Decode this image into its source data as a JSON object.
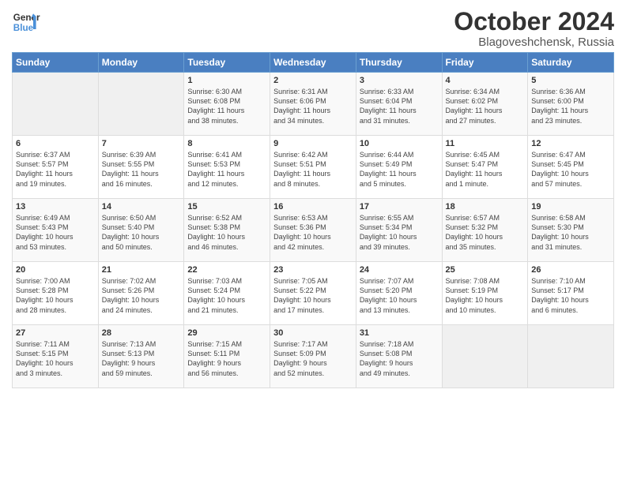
{
  "logo": {
    "line1": "General",
    "line2": "Blue"
  },
  "title": "October 2024",
  "location": "Blagoveshchensk, Russia",
  "days_of_week": [
    "Sunday",
    "Monday",
    "Tuesday",
    "Wednesday",
    "Thursday",
    "Friday",
    "Saturday"
  ],
  "weeks": [
    [
      {
        "day": "",
        "info": ""
      },
      {
        "day": "",
        "info": ""
      },
      {
        "day": "1",
        "info": "Sunrise: 6:30 AM\nSunset: 6:08 PM\nDaylight: 11 hours\nand 38 minutes."
      },
      {
        "day": "2",
        "info": "Sunrise: 6:31 AM\nSunset: 6:06 PM\nDaylight: 11 hours\nand 34 minutes."
      },
      {
        "day": "3",
        "info": "Sunrise: 6:33 AM\nSunset: 6:04 PM\nDaylight: 11 hours\nand 31 minutes."
      },
      {
        "day": "4",
        "info": "Sunrise: 6:34 AM\nSunset: 6:02 PM\nDaylight: 11 hours\nand 27 minutes."
      },
      {
        "day": "5",
        "info": "Sunrise: 6:36 AM\nSunset: 6:00 PM\nDaylight: 11 hours\nand 23 minutes."
      }
    ],
    [
      {
        "day": "6",
        "info": "Sunrise: 6:37 AM\nSunset: 5:57 PM\nDaylight: 11 hours\nand 19 minutes."
      },
      {
        "day": "7",
        "info": "Sunrise: 6:39 AM\nSunset: 5:55 PM\nDaylight: 11 hours\nand 16 minutes."
      },
      {
        "day": "8",
        "info": "Sunrise: 6:41 AM\nSunset: 5:53 PM\nDaylight: 11 hours\nand 12 minutes."
      },
      {
        "day": "9",
        "info": "Sunrise: 6:42 AM\nSunset: 5:51 PM\nDaylight: 11 hours\nand 8 minutes."
      },
      {
        "day": "10",
        "info": "Sunrise: 6:44 AM\nSunset: 5:49 PM\nDaylight: 11 hours\nand 5 minutes."
      },
      {
        "day": "11",
        "info": "Sunrise: 6:45 AM\nSunset: 5:47 PM\nDaylight: 11 hours\nand 1 minute."
      },
      {
        "day": "12",
        "info": "Sunrise: 6:47 AM\nSunset: 5:45 PM\nDaylight: 10 hours\nand 57 minutes."
      }
    ],
    [
      {
        "day": "13",
        "info": "Sunrise: 6:49 AM\nSunset: 5:43 PM\nDaylight: 10 hours\nand 53 minutes."
      },
      {
        "day": "14",
        "info": "Sunrise: 6:50 AM\nSunset: 5:40 PM\nDaylight: 10 hours\nand 50 minutes."
      },
      {
        "day": "15",
        "info": "Sunrise: 6:52 AM\nSunset: 5:38 PM\nDaylight: 10 hours\nand 46 minutes."
      },
      {
        "day": "16",
        "info": "Sunrise: 6:53 AM\nSunset: 5:36 PM\nDaylight: 10 hours\nand 42 minutes."
      },
      {
        "day": "17",
        "info": "Sunrise: 6:55 AM\nSunset: 5:34 PM\nDaylight: 10 hours\nand 39 minutes."
      },
      {
        "day": "18",
        "info": "Sunrise: 6:57 AM\nSunset: 5:32 PM\nDaylight: 10 hours\nand 35 minutes."
      },
      {
        "day": "19",
        "info": "Sunrise: 6:58 AM\nSunset: 5:30 PM\nDaylight: 10 hours\nand 31 minutes."
      }
    ],
    [
      {
        "day": "20",
        "info": "Sunrise: 7:00 AM\nSunset: 5:28 PM\nDaylight: 10 hours\nand 28 minutes."
      },
      {
        "day": "21",
        "info": "Sunrise: 7:02 AM\nSunset: 5:26 PM\nDaylight: 10 hours\nand 24 minutes."
      },
      {
        "day": "22",
        "info": "Sunrise: 7:03 AM\nSunset: 5:24 PM\nDaylight: 10 hours\nand 21 minutes."
      },
      {
        "day": "23",
        "info": "Sunrise: 7:05 AM\nSunset: 5:22 PM\nDaylight: 10 hours\nand 17 minutes."
      },
      {
        "day": "24",
        "info": "Sunrise: 7:07 AM\nSunset: 5:20 PM\nDaylight: 10 hours\nand 13 minutes."
      },
      {
        "day": "25",
        "info": "Sunrise: 7:08 AM\nSunset: 5:19 PM\nDaylight: 10 hours\nand 10 minutes."
      },
      {
        "day": "26",
        "info": "Sunrise: 7:10 AM\nSunset: 5:17 PM\nDaylight: 10 hours\nand 6 minutes."
      }
    ],
    [
      {
        "day": "27",
        "info": "Sunrise: 7:11 AM\nSunset: 5:15 PM\nDaylight: 10 hours\nand 3 minutes."
      },
      {
        "day": "28",
        "info": "Sunrise: 7:13 AM\nSunset: 5:13 PM\nDaylight: 9 hours\nand 59 minutes."
      },
      {
        "day": "29",
        "info": "Sunrise: 7:15 AM\nSunset: 5:11 PM\nDaylight: 9 hours\nand 56 minutes."
      },
      {
        "day": "30",
        "info": "Sunrise: 7:17 AM\nSunset: 5:09 PM\nDaylight: 9 hours\nand 52 minutes."
      },
      {
        "day": "31",
        "info": "Sunrise: 7:18 AM\nSunset: 5:08 PM\nDaylight: 9 hours\nand 49 minutes."
      },
      {
        "day": "",
        "info": ""
      },
      {
        "day": "",
        "info": ""
      }
    ]
  ]
}
